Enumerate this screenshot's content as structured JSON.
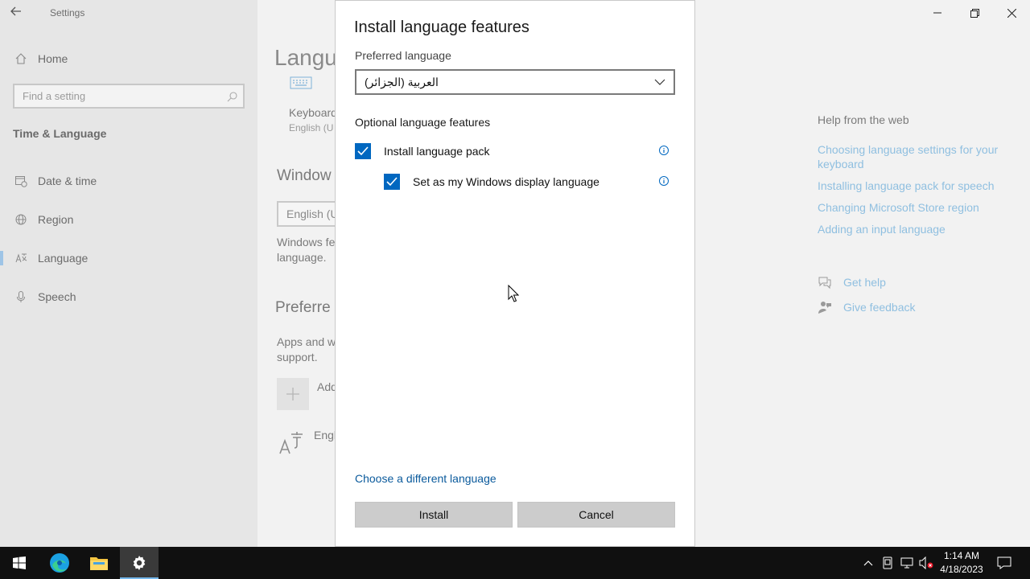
{
  "window": {
    "app_title": "Settings"
  },
  "sidebar": {
    "home_label": "Home",
    "search_placeholder": "Find a setting",
    "section_title": "Time & Language",
    "items": [
      {
        "label": "Date & time",
        "icon": "calendar-clock-icon"
      },
      {
        "label": "Region",
        "icon": "globe-icon"
      },
      {
        "label": "Language",
        "icon": "language-icon",
        "active": true
      },
      {
        "label": "Speech",
        "icon": "microphone-icon"
      }
    ]
  },
  "main": {
    "title_partial": "Langu",
    "keyboard_label": "Keyboard",
    "keyboard_sub": "English (U",
    "windows_heading": "Window",
    "display_lang_value": "English (U",
    "windows_desc_1": "Windows fe",
    "windows_desc_2": "language.",
    "preferred_heading": "Preferre",
    "apps_desc_1": "Apps and w",
    "apps_desc_2": "support.",
    "add_label": "Add",
    "english_label": "Engl"
  },
  "help": {
    "heading": "Help from the web",
    "links": [
      "Choosing language settings for your keyboard",
      "Installing language pack for speech",
      "Changing Microsoft Store region",
      "Adding an input language"
    ],
    "get_help": "Get help",
    "give_feedback": "Give feedback"
  },
  "dialog": {
    "title": "Install language features",
    "preferred_label": "Preferred language",
    "preferred_value": "العربية (الجزائر)",
    "optional_heading": "Optional language features",
    "install_pack_label": "Install language pack",
    "install_pack_checked": true,
    "display_lang_label": "Set as my Windows display language",
    "display_lang_checked": true,
    "choose_link": "Choose a different language",
    "install_button": "Install",
    "cancel_button": "Cancel"
  },
  "taskbar": {
    "time": "1:14 AM",
    "date": "4/18/2023"
  },
  "colors": {
    "accent": "#0067c0",
    "link": "#0a5a9c",
    "help_link": "#8fbfe0",
    "taskbar": "#101010"
  }
}
